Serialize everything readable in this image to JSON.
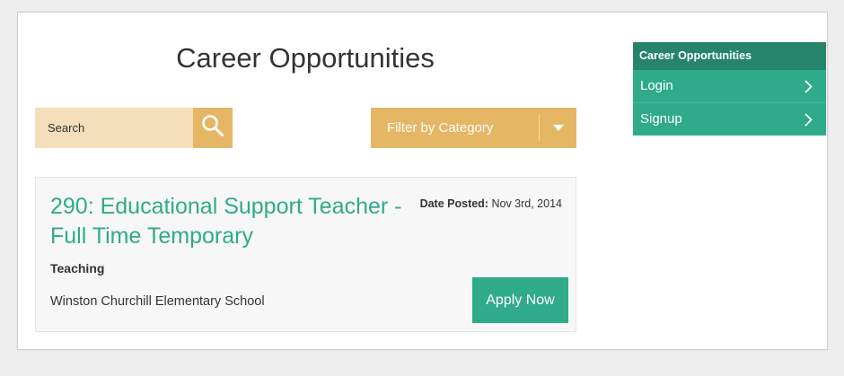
{
  "header": {
    "title": "Career Opportunities"
  },
  "search": {
    "placeholder": "Search",
    "button_icon": "search-icon"
  },
  "filter": {
    "label": "Filter by Category",
    "icon": "caret-down-icon"
  },
  "job": {
    "title": "290: Educational Support Teacher - Full Time Temporary",
    "date_label": "Date Posted:",
    "date_value": "Nov 3rd, 2014",
    "category": "Teaching",
    "school": "Winston Churchill Elementary School",
    "apply_label": "Apply Now"
  },
  "sidebar": {
    "heading": "Career Opportunities",
    "items": [
      {
        "label": "Login",
        "icon": "chevron-right-icon"
      },
      {
        "label": "Signup",
        "icon": "chevron-right-icon"
      }
    ]
  },
  "colors": {
    "accent_green": "#2fab89",
    "dark_green": "#25846a",
    "gold": "#e5b765",
    "light_gold": "#f5dfbb"
  }
}
